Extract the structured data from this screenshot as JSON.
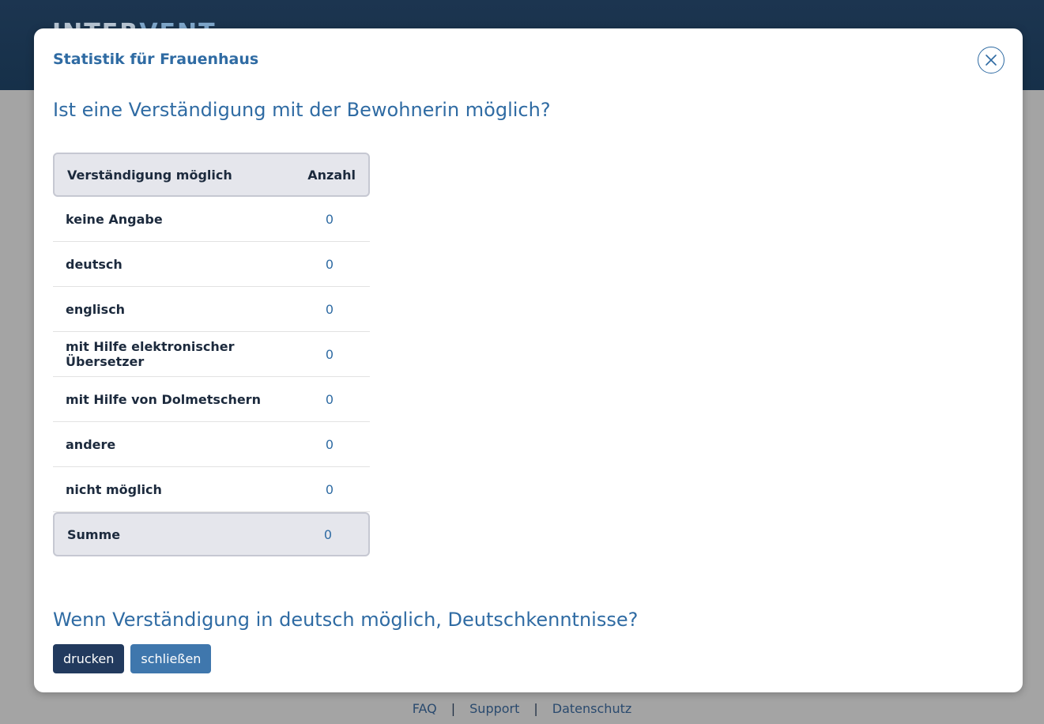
{
  "app": {
    "logo_main": "INTER",
    "logo_accent": "VENT"
  },
  "modal": {
    "title": "Statistik für Frauenhaus",
    "sections": [
      {
        "heading": "Ist eine Verständigung mit der Bewohnerin möglich?"
      },
      {
        "heading": "Wenn Verständigung in deutsch möglich, Deutschkenntnisse?"
      }
    ],
    "table": {
      "headers": [
        "Verständigung möglich",
        "Anzahl"
      ],
      "rows": [
        {
          "label": "keine Angabe",
          "count": "0"
        },
        {
          "label": "deutsch",
          "count": "0"
        },
        {
          "label": "englisch",
          "count": "0"
        },
        {
          "label": "mit Hilfe elektronischer Übersetzer",
          "count": "0"
        },
        {
          "label": "mit Hilfe von Dolmetschern",
          "count": "0"
        },
        {
          "label": "andere",
          "count": "0"
        },
        {
          "label": "nicht möglich",
          "count": "0"
        }
      ],
      "sum": {
        "label": "Summe",
        "count": "0"
      }
    },
    "buttons": {
      "print": "drucken",
      "close": "schließen"
    },
    "close_icon": "close-icon"
  },
  "footer": {
    "links": [
      "FAQ",
      "Support",
      "Datenschutz"
    ],
    "separator": "|"
  },
  "colors": {
    "accent": "#2f6ba3",
    "header": "#1c3550",
    "primary_button": "#223a5e",
    "secondary_button": "#3f77ad"
  }
}
